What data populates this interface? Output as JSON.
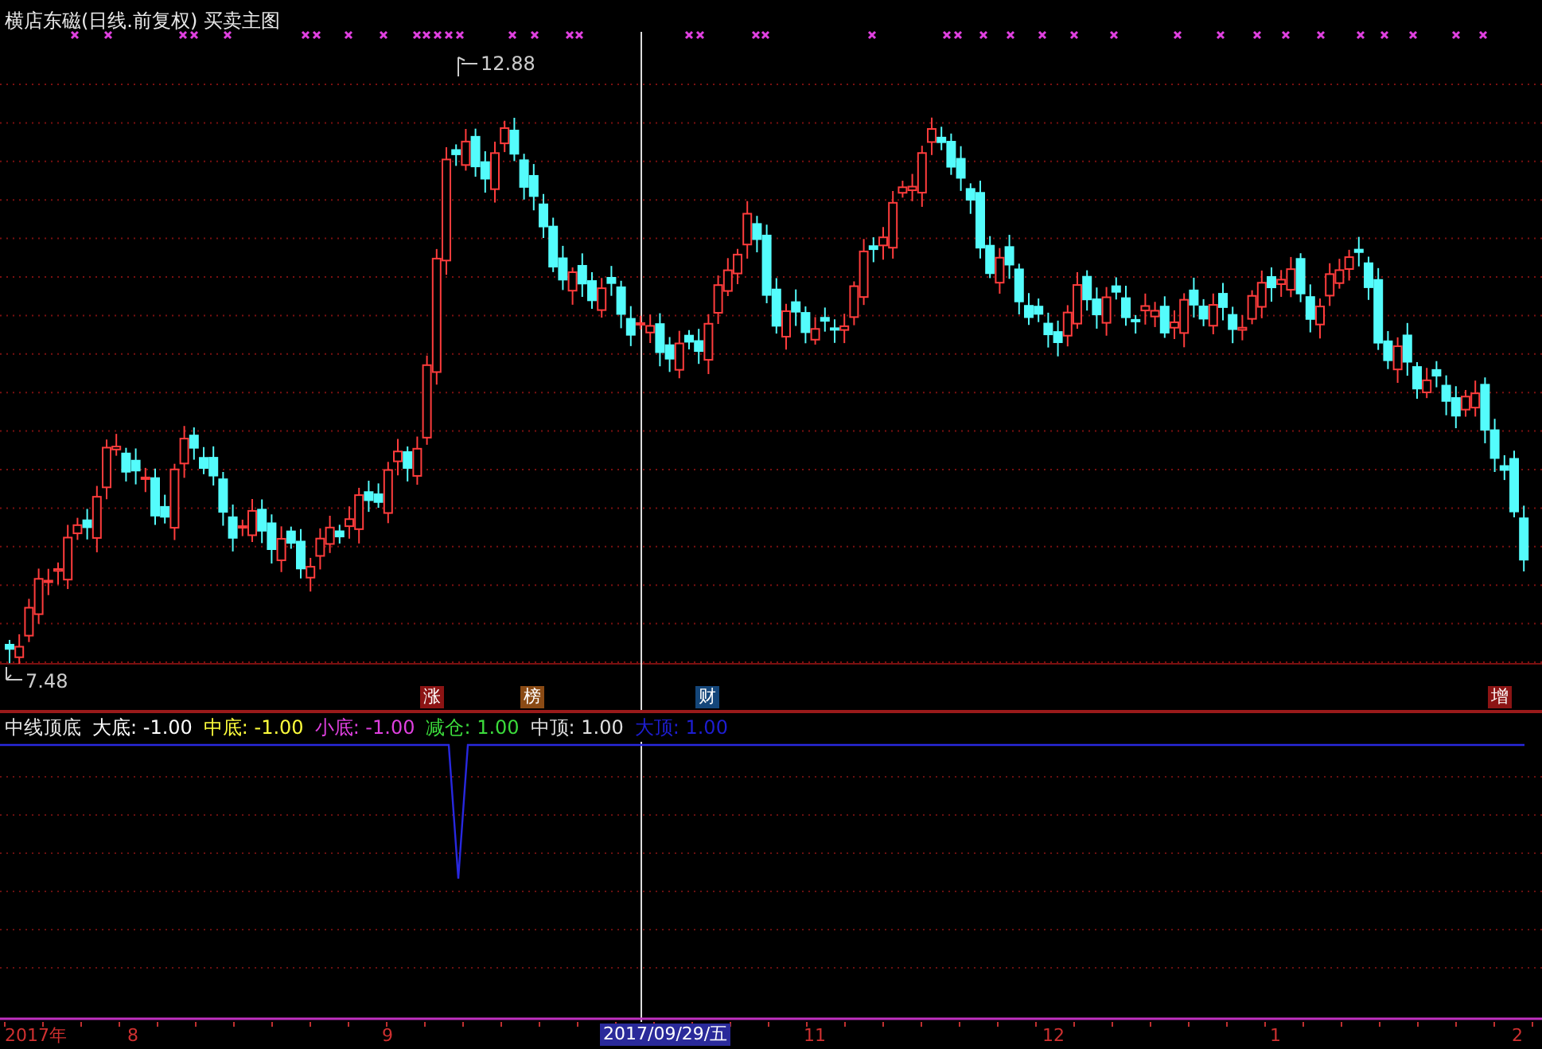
{
  "title": "横店东磁(日线.前复权) 买卖主图",
  "price_labels": {
    "high": "12.88",
    "low": "7.48"
  },
  "events": [
    {
      "label": "涨",
      "color": "#8c1414"
    },
    {
      "label": "榜",
      "color": "#8a4a14"
    },
    {
      "label": "财",
      "color": "#14467a"
    },
    {
      "label": "增",
      "color": "#8c1414"
    }
  ],
  "indicator": {
    "name": "中线顶底",
    "items": [
      {
        "text": "大底: -1.00",
        "color": "#ffffff"
      },
      {
        "text": "中底: -1.00",
        "color": "#ffff3c"
      },
      {
        "text": "小底: -1.00",
        "color": "#e040e0"
      },
      {
        "text": "减仓: 1.00",
        "color": "#3cdc3c"
      },
      {
        "text": "中顶: 1.00",
        "color": "#e0e0e0"
      },
      {
        "text": "大顶: 1.00",
        "color": "#1e1ed2"
      }
    ]
  },
  "time_axis": {
    "labels": [
      "2017年",
      "8",
      "9",
      "11",
      "12",
      "1",
      "2"
    ],
    "cursor_date": "2017/09/29/五"
  }
}
